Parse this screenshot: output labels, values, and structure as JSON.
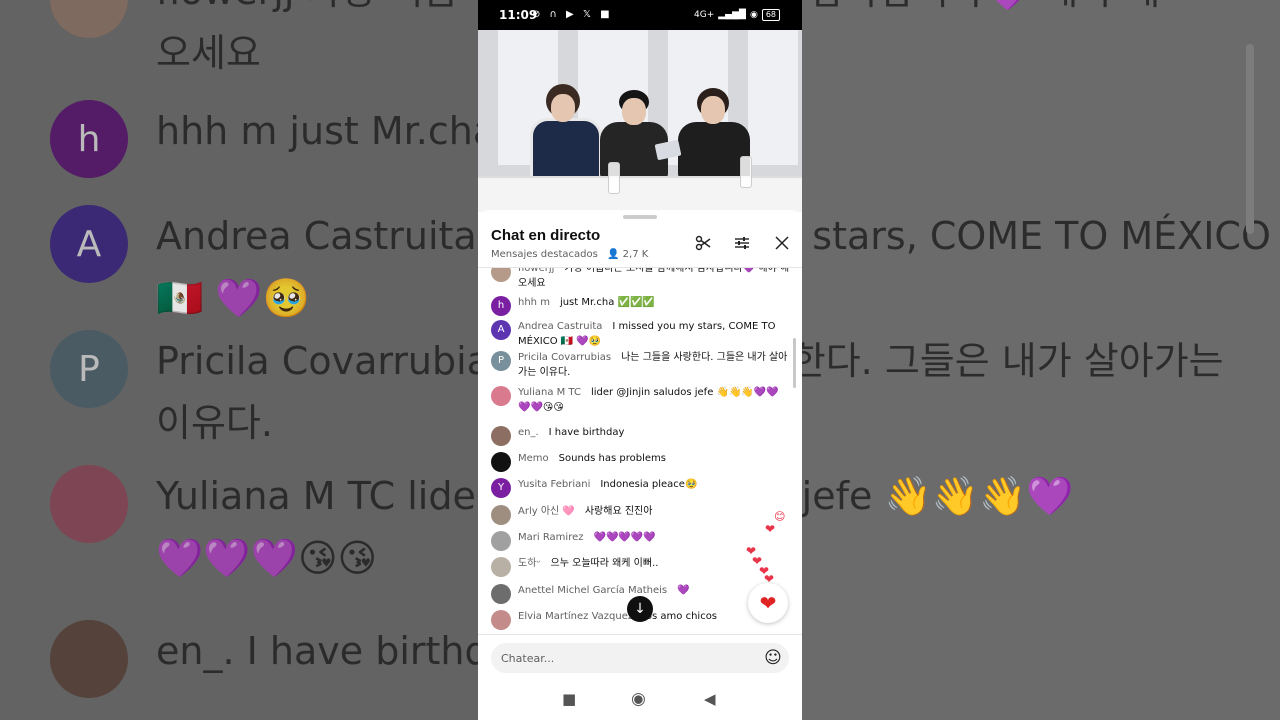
{
  "status_bar": {
    "time": "11:09",
    "left_icons": "⊘ ∩ ▶ 𝕏 ■",
    "network": "4G+",
    "signal": "▂▄▆█",
    "wifi": "◉",
    "battery": "68"
  },
  "chat_header": {
    "title": "Chat en directo",
    "subtitle": "Mensajes destacados",
    "viewer_count": "2,7 K",
    "icons": [
      "scissors-icon",
      "tune-icon",
      "close-icon"
    ]
  },
  "messages": [
    {
      "author": "flowerjj",
      "text": "가장 어둡다는 오시를 함께해서 감사합니다💜 해야 해 오세요",
      "avatar_color": "#b59a8a",
      "avatar_letter": ""
    },
    {
      "author": "hhh m",
      "text": "just Mr.cha ✅✅✅",
      "avatar_color": "#7b1fa2",
      "avatar_letter": "h"
    },
    {
      "author": "Andrea Castruita",
      "text": "I missed you my stars, COME TO MÉXICO 🇲🇽 💜🥹",
      "avatar_color": "#5e35b1",
      "avatar_letter": "A"
    },
    {
      "author": "Pricila Covarrubias",
      "text": "나는 그들을 사랑한다. 그들은 내가 살아가는 이유다.",
      "avatar_color": "#78909c",
      "avatar_letter": "P"
    },
    {
      "author": "Yuliana M TC",
      "text": "lider @Jinjin saludos jefe 👋👋👋💜💜💜💜😘😘",
      "avatar_color": "#d97a8f",
      "avatar_letter": ""
    },
    {
      "author": "en_.",
      "text": "I have birthday",
      "avatar_color": "#8d6e63",
      "avatar_letter": ""
    },
    {
      "author": "Memo",
      "text": "Sounds has problems",
      "avatar_color": "#111111",
      "avatar_letter": ""
    },
    {
      "author": "Yusita Febriani",
      "text": "Indonesia pleace🥹",
      "avatar_color": "#7b1fa2",
      "avatar_letter": "Y"
    },
    {
      "author": "Arly 아신 🩷",
      "text": "사랑해요 진진아",
      "avatar_color": "#9e8e80",
      "avatar_letter": ""
    },
    {
      "author": "Mari Ramirez",
      "text": "💜💜💜💜💜",
      "avatar_color": "#a0a0a0",
      "avatar_letter": ""
    },
    {
      "author": "도하ᵕ",
      "text": "으누 오늘따라 왜케 이뻐..",
      "avatar_color": "#b8b0a4",
      "avatar_letter": ""
    },
    {
      "author": "Anettel Michel García Matheis",
      "text": "💜",
      "avatar_color": "#6d6d6d",
      "avatar_letter": ""
    },
    {
      "author": "Elvia Martínez Vazquez",
      "text": "los amo chicos",
      "avatar_color": "#c48b8b",
      "avatar_letter": ""
    }
  ],
  "input": {
    "placeholder": "Chatear..."
  },
  "reaction": {
    "heart": "❤",
    "jump": "↓"
  },
  "nav": {
    "back": "◀",
    "home": "◉",
    "recents": "■"
  },
  "background": {
    "rows": [
      {
        "letter": "",
        "text": "flowerjj   가장 어둡다는 오시를 함께해서 감사합니다💜 해야 해",
        "line2": "오세요",
        "color": "#8a7466"
      },
      {
        "letter": "h",
        "text": "hhh m     just Mr.cha",
        "line2": "",
        "color": "#5a1a70"
      },
      {
        "letter": "A",
        "text": "Andrea Castruita         I missed you my stars, COME TO MÉXICO",
        "line2": "🇲🇽 💜🥹",
        "color": "#3f2a80"
      },
      {
        "letter": "P",
        "text": "Pricila Covarrubias    나는 그들을 사랑한다. 그들은 내가 살아가는",
        "line2": "이유다.",
        "color": "#50626b"
      },
      {
        "letter": "",
        "text": "Yuliana M TC     lider @Jinjin saludos jefe 👋👋👋💜",
        "line2": "💜💜💜😘😘",
        "color": "#8a4b5c"
      },
      {
        "letter": "",
        "text": "en_.    I have birthday",
        "line2": "",
        "color": "#5a463e"
      }
    ]
  }
}
